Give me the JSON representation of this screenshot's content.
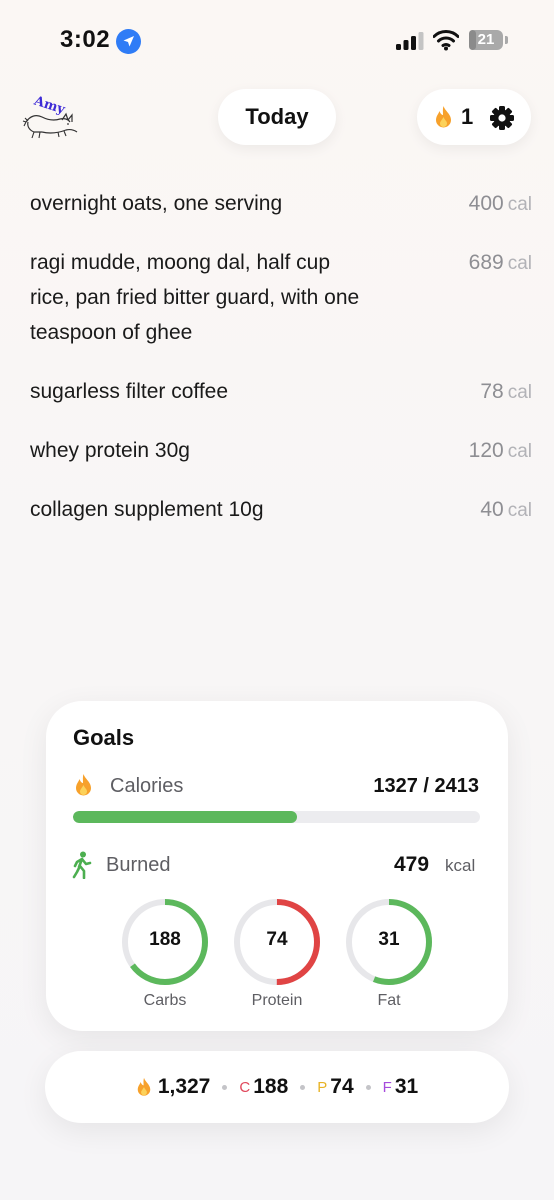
{
  "status_bar": {
    "time": "3:02",
    "battery": "21",
    "battery_level": 0.21
  },
  "header": {
    "avatar_text": "Amy",
    "today_label": "Today",
    "streak_count": "1"
  },
  "food_log": [
    {
      "name": "overnight oats, one serving",
      "calories": "400",
      "unit": "cal"
    },
    {
      "name": "ragi mudde, moong dal, half cup rice, pan fried bitter guard, with one teaspoon of ghee",
      "calories": "689",
      "unit": "cal"
    },
    {
      "name": "sugarless filter coffee",
      "calories": "78",
      "unit": "cal"
    },
    {
      "name": "whey protein 30g",
      "calories": "120",
      "unit": "cal"
    },
    {
      "name": "collagen supplement 10g",
      "calories": "40",
      "unit": "cal"
    }
  ],
  "goals": {
    "title": "Goals",
    "calories_label": "Calories",
    "calories_value": "1327 / 2413",
    "calories_progress": 0.55,
    "burned_label": "Burned",
    "burned_value": "479",
    "burned_unit": "kcal",
    "macros": [
      {
        "label": "Carbs",
        "value": "188",
        "progress": 0.65,
        "color": "#5cb85c"
      },
      {
        "label": "Protein",
        "value": "74",
        "progress": 0.5,
        "color": "#e04444"
      },
      {
        "label": "Fat",
        "value": "31",
        "progress": 0.56,
        "color": "#5cb85c"
      }
    ]
  },
  "summary": {
    "calories": "1,327",
    "carbs_letter": "C",
    "carbs": "188",
    "protein_letter": "P",
    "protein": "74",
    "fat_letter": "F",
    "fat": "31"
  },
  "colors": {
    "green": "#5cb85c",
    "red": "#e04444",
    "carbs_letter": "#e0475b",
    "protein_letter": "#e8b325",
    "fat_letter": "#a64bdc",
    "location_blue": "#2f7cf6"
  }
}
